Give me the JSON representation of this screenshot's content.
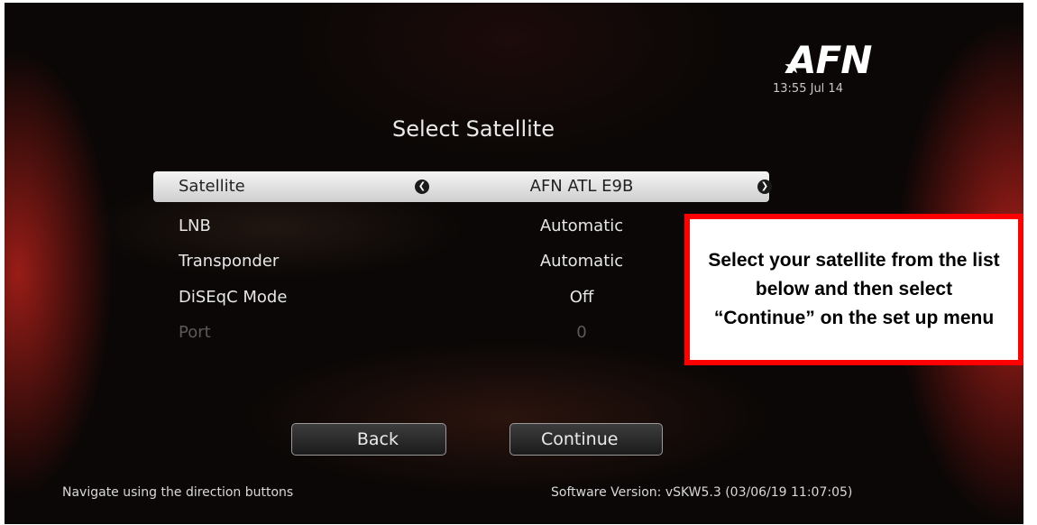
{
  "brand": {
    "logo_text": "AFN"
  },
  "status": {
    "time": "13:55",
    "date": "Jul 14"
  },
  "page": {
    "title": "Select Satellite"
  },
  "settings": [
    {
      "label": "Satellite",
      "value": "AFN ATL E9B",
      "selected": true
    },
    {
      "label": "LNB",
      "value": "Automatic"
    },
    {
      "label": "Transponder",
      "value": "Automatic"
    },
    {
      "label": "DiSEqC Mode",
      "value": "Off"
    },
    {
      "label": "Port",
      "value": "0",
      "disabled": true
    }
  ],
  "buttons": {
    "back": "Back",
    "continue": "Continue"
  },
  "footer": {
    "hint": "Navigate using the direction buttons",
    "version": "Software Version: vSKW5.3 (03/06/19 11:07:05)"
  },
  "callout": {
    "text": "Select your satellite from the list below and then select “Continue” on the set up menu"
  },
  "icons": {
    "left": "chevron-left-icon",
    "right": "chevron-right-icon"
  },
  "colors": {
    "callout_border": "#ff0000",
    "background": "#0a0706",
    "accent_red": "#b2201a"
  }
}
